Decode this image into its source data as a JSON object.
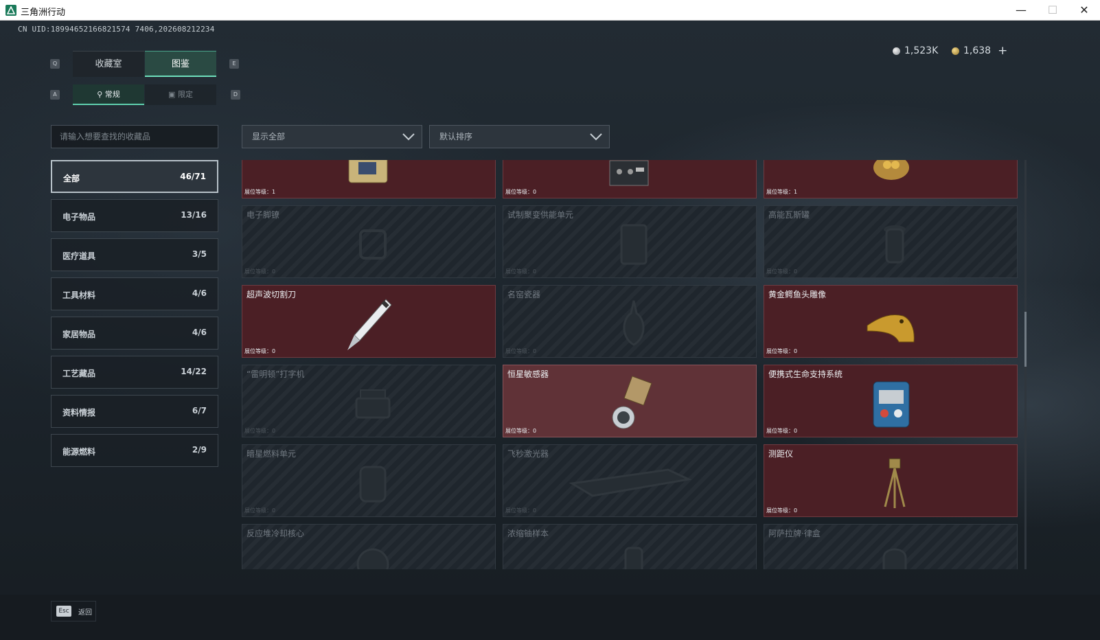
{
  "window": {
    "title": "三角洲行动",
    "min": "—",
    "max": "☐",
    "close": "✕"
  },
  "uid": "CN UID:18994652166821574 7406,202608212234",
  "currency": {
    "silver": "1,523K",
    "gold": "1,638",
    "add": "+"
  },
  "tabs": {
    "prev_key": "Q",
    "next_key": "E",
    "items": [
      {
        "label": "收藏室"
      },
      {
        "label": "图鉴"
      }
    ]
  },
  "subtabs": {
    "prev_key": "A",
    "next_key": "D",
    "items": [
      {
        "label": "常规"
      },
      {
        "label": "限定"
      }
    ]
  },
  "search": {
    "placeholder": "请输入想要查找的收藏品"
  },
  "filter": {
    "label": "显示全部"
  },
  "sort": {
    "label": "默认排序"
  },
  "categories": [
    {
      "label": "全部",
      "count": "46/71"
    },
    {
      "label": "电子物品",
      "count": "13/16"
    },
    {
      "label": "医疗道具",
      "count": "3/5"
    },
    {
      "label": "工具材料",
      "count": "4/6"
    },
    {
      "label": "家居物品",
      "count": "4/6"
    },
    {
      "label": "工艺藏品",
      "count": "14/22"
    },
    {
      "label": "资料情报",
      "count": "6/7"
    },
    {
      "label": "能源燃料",
      "count": "2/9"
    }
  ],
  "cards": [
    {
      "name": "",
      "level": "展位等级：1",
      "state": "red",
      "icon": "device-icon"
    },
    {
      "name": "",
      "level": "展位等级：0",
      "state": "red",
      "icon": "radio-icon"
    },
    {
      "name": "",
      "level": "展位等级：1",
      "state": "red",
      "icon": "nest-icon"
    },
    {
      "name": "电子脚镣",
      "level": "展位等级：0",
      "state": "locked",
      "icon": "shackle-icon"
    },
    {
      "name": "试制聚变供能单元",
      "level": "展位等级：0",
      "state": "locked",
      "icon": "fusion-unit-icon"
    },
    {
      "name": "高能瓦斯罐",
      "level": "展位等级：0",
      "state": "locked",
      "icon": "gas-tank-icon"
    },
    {
      "name": "超声波切割刀",
      "level": "展位等级：0",
      "state": "red",
      "icon": "ultrasonic-knife-icon"
    },
    {
      "name": "名窑瓷器",
      "level": "展位等级：0",
      "state": "locked",
      "icon": "porcelain-icon"
    },
    {
      "name": "黄金鳄鱼头雕像",
      "level": "展位等级：0",
      "state": "red",
      "icon": "gold-crocodile-icon"
    },
    {
      "name": "“雷明顿”打字机",
      "level": "展位等级：0",
      "state": "locked",
      "icon": "typewriter-icon"
    },
    {
      "name": "恒星敏感器",
      "level": "展位等级：0",
      "state": "red-light",
      "icon": "star-sensor-icon"
    },
    {
      "name": "便携式生命支持系统",
      "level": "展位等级：0",
      "state": "red",
      "icon": "life-support-icon"
    },
    {
      "name": "暗星燃料单元",
      "level": "展位等级：0",
      "state": "locked",
      "icon": "fuel-cell-icon"
    },
    {
      "name": "飞秒激光器",
      "level": "展位等级：0",
      "state": "locked",
      "icon": "laser-icon"
    },
    {
      "name": "测距仪",
      "level": "展位等级：0",
      "state": "red",
      "icon": "rangefinder-icon"
    },
    {
      "name": "反应堆冷却核心",
      "level": "",
      "state": "locked",
      "icon": "reactor-core-icon"
    },
    {
      "name": "浓缩铀样本",
      "level": "",
      "state": "locked",
      "icon": "uranium-icon"
    },
    {
      "name": "阿萨拉牌·律盒",
      "level": "",
      "state": "locked",
      "icon": "box-icon"
    }
  ],
  "footer": {
    "key": "Esc",
    "back": "返回"
  }
}
